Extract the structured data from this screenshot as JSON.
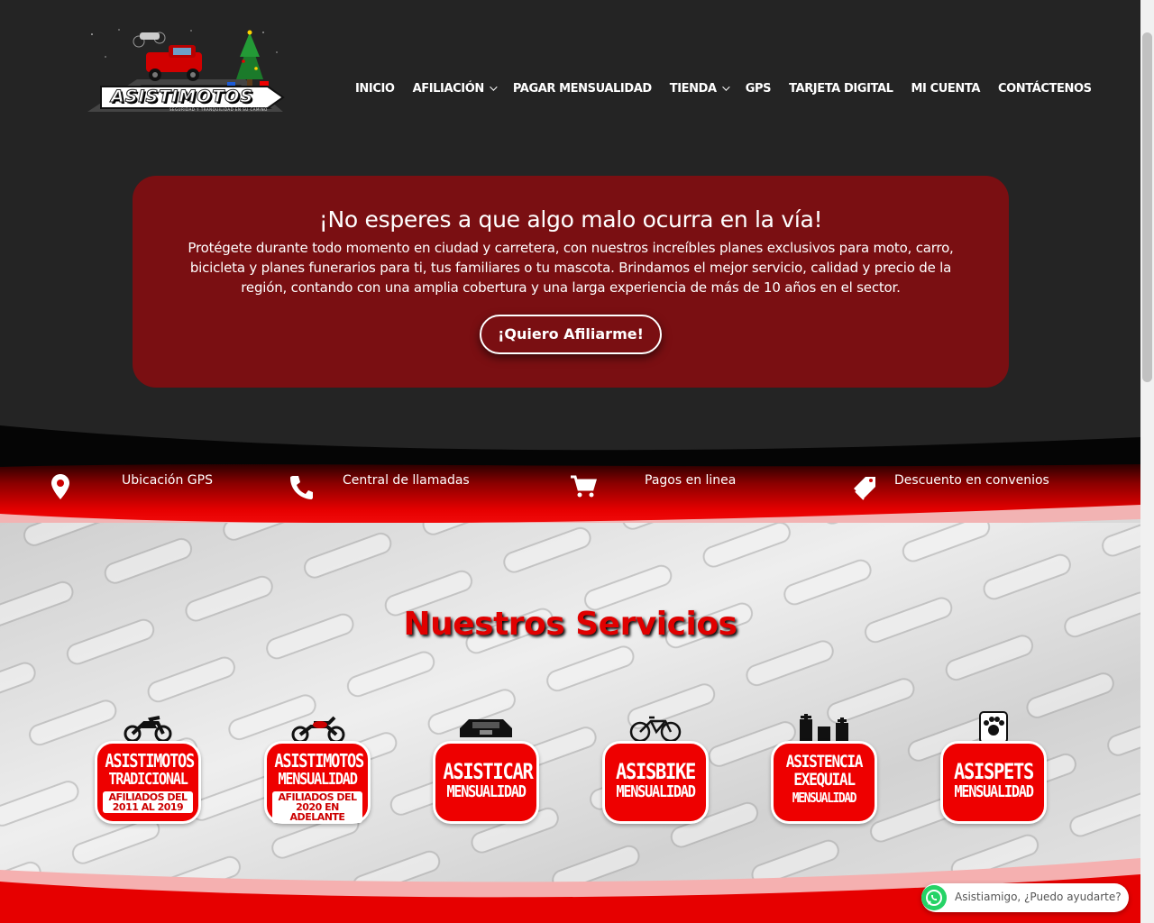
{
  "brand": {
    "name": "ASISTIMOTOS",
    "tagline": "SEGURIDAD Y TRANQUILIDAD EN SU CAMINO"
  },
  "nav": {
    "items": [
      {
        "label": "INICIO",
        "dropdown": false
      },
      {
        "label": "AFILIACIÓN",
        "dropdown": true
      },
      {
        "label": "PAGAR MENSUALIDAD",
        "dropdown": false
      },
      {
        "label": "TIENDA",
        "dropdown": true
      },
      {
        "label": "GPS",
        "dropdown": false
      },
      {
        "label": "TARJETA DIGITAL",
        "dropdown": false
      },
      {
        "label": "MI CUENTA",
        "dropdown": false
      },
      {
        "label": "CONTÁCTENOS",
        "dropdown": false
      }
    ]
  },
  "hero": {
    "title": "¡No esperes a que algo malo ocurra en la vía!",
    "text": "Protégete durante todo momento en ciudad y carretera, con nuestros increíbles planes exclusivos para moto, carro, bicicleta y planes funerarios para ti, tus familiares o tu mascota. Brindamos el mejor servicio, calidad y precio de la región, contando con una amplia cobertura y una larga experiencia de más de 10 años en el sector.",
    "button": "¡Quiero Afiliarme!"
  },
  "features": [
    {
      "label": "Ubicación GPS",
      "icon": "map-pin-icon"
    },
    {
      "label": "Central de llamadas",
      "icon": "phone-icon"
    },
    {
      "label": "Pagos en linea",
      "icon": "cart-icon"
    },
    {
      "label": "Descuento en convenios",
      "icon": "tag-icon"
    }
  ],
  "services": {
    "title": "Nuestros Servicios",
    "items": [
      {
        "line1": "ASISTIMOTOS",
        "line2": "TRADICIONAL",
        "tag": "AFILIADOS DEL 2011 AL 2019",
        "icon": "motorcycle-icon"
      },
      {
        "line1": "ASISTIMOTOS",
        "line2": "MENSUALIDAD",
        "tag": "AFILIADOS DEL 2020 EN ADELANTE",
        "icon": "chopper-icon"
      },
      {
        "line1": "ASISTICAR",
        "line2": "MENSUALIDAD",
        "tag": "",
        "icon": "car-icon"
      },
      {
        "line1": "ASISBIKE",
        "line2": "MENSUALIDAD",
        "tag": "",
        "icon": "bicycle-icon"
      },
      {
        "line1": "ASISTENCIA EXEQUIAL",
        "line2": "MENSUALIDAD",
        "tag": "",
        "icon": "tombstone-icon"
      },
      {
        "line1": "ASISPETS",
        "line2": "MENSUALIDAD",
        "tag": "",
        "icon": "paw-icon"
      }
    ]
  },
  "whatsapp": {
    "text": "Asistiamigo, ¿Puedo ayudarte?"
  },
  "colors": {
    "accent_red": "#ee0000",
    "hero_bg": "#7a0f12",
    "header_bg": "#242424"
  }
}
